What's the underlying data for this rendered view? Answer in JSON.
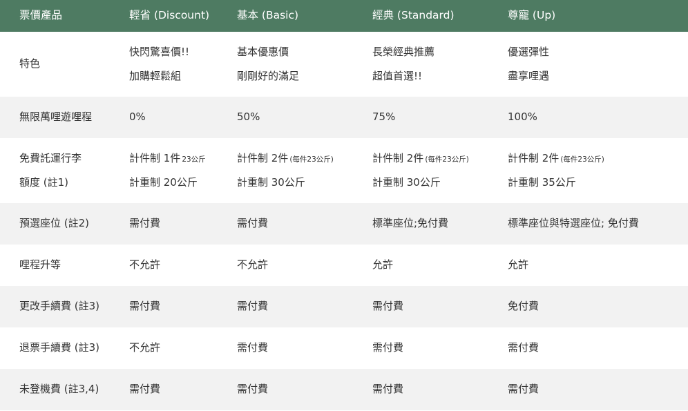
{
  "header": [
    "票價產品",
    "輕省 (Discount)",
    "基本 (Basic)",
    "經典 (Standard)",
    "尊寵 (Up)"
  ],
  "rows": {
    "features": {
      "label": "特色",
      "c1": [
        "快閃驚喜價!!",
        "加購輕鬆組"
      ],
      "c2": [
        "基本優惠價",
        "剛剛好的滿足"
      ],
      "c3": [
        "長榮經典推薦",
        "超值首選!!"
      ],
      "c4": [
        "優選彈性",
        "盡享哩遇"
      ]
    },
    "mileage": {
      "label": "無限萬哩遊哩程",
      "values": [
        "0%",
        "50%",
        "75%",
        "100%"
      ]
    },
    "baggage": {
      "label": [
        "免費託運行李",
        "額度 (註1)"
      ],
      "c1": {
        "piece": "計件制 1件",
        "piece_note": "23公斤",
        "weight": "計重制 20公斤"
      },
      "c2": {
        "piece": "計件制 2件",
        "piece_note": "(每件23公斤)",
        "weight": "計重制 30公斤"
      },
      "c3": {
        "piece": "計件制 2件",
        "piece_note": "(每件23公斤)",
        "weight": "計重制 30公斤"
      },
      "c4": {
        "piece": "計件制 2件",
        "piece_note": "(每件23公斤)",
        "weight": "計重制 35公斤"
      }
    },
    "seat": {
      "label": "預選座位 (註2)",
      "values": [
        "需付費",
        "需付費",
        "標準座位;免付費",
        "標準座位與特選座位; 免付費"
      ]
    },
    "upgrade": {
      "label": "哩程升等",
      "values": [
        "不允許",
        "不允許",
        "允許",
        "允許"
      ]
    },
    "change": {
      "label": "更改手續費 (註3)",
      "values": [
        "需付費",
        "需付費",
        "需付費",
        "免付費"
      ]
    },
    "refund": {
      "label": "退票手續費 (註3)",
      "values": [
        "不允許",
        "需付費",
        "需付費",
        "需付費"
      ]
    },
    "noshow": {
      "label": "未登機費 (註3,4)",
      "values": [
        "需付費",
        "需付費",
        "需付費",
        "需付費"
      ]
    }
  },
  "colors": {
    "header_bg": "#4e7b62",
    "header_text": "#ffffff",
    "alt_row_bg": "#f2f2f2",
    "text": "#333333"
  }
}
